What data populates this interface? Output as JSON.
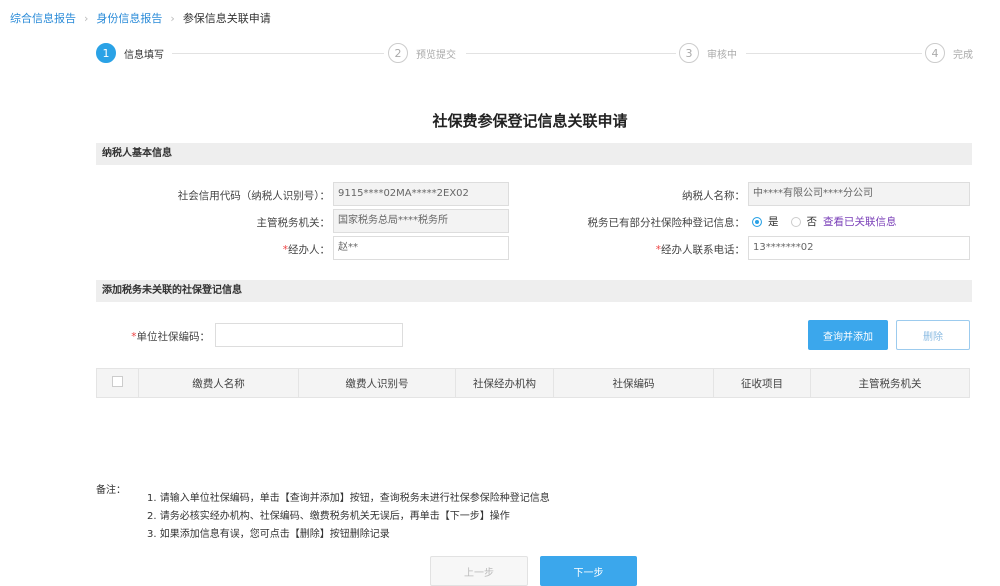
{
  "breadcrumb": [
    "综合信息报告",
    "身份信息报告",
    "参保信息关联申请"
  ],
  "steps": [
    {
      "num": "1",
      "label": "信息填写"
    },
    {
      "num": "2",
      "label": "预览提交"
    },
    {
      "num": "3",
      "label": "审核中"
    },
    {
      "num": "4",
      "label": "完成"
    }
  ],
  "title": "社保费参保登记信息关联申请",
  "section1": {
    "header": "纳税人基本信息",
    "credit_code_label": "社会信用代码（纳税人识别号）：",
    "credit_code_value": "9115****02MA*****2EX02",
    "taxpayer_name_label": "纳税人名称：",
    "taxpayer_name_value": "中****有限公司****分公司",
    "tax_authority_label": "主管税务机关：",
    "tax_authority_value": "国家税务总局****税务所",
    "registered_label": "税务已有部分社保险种登记信息：",
    "yes": "是",
    "no": "否",
    "view_link": "查看已关联信息",
    "handler_label": "经办人：",
    "handler_value": "赵**",
    "phone_label": "经办人联系电话：",
    "phone_value": "13*******02"
  },
  "section2": {
    "header": "添加税务未关联的社保登记信息",
    "unit_code_label": "单位社保编码：",
    "unit_code_value": "",
    "query_add": "查询并添加",
    "delete": "删除"
  },
  "table": {
    "columns": [
      "缴费人名称",
      "缴费人识别号",
      "社保经办机构",
      "社保编码",
      "征收项目",
      "主管税务机关"
    ]
  },
  "notes": {
    "title": "备注：",
    "items": [
      "1. 请输入单位社保编码，单击【查询并添加】按钮，查询税务未进行社保参保险种登记信息",
      "2. 请务必核实经办机构、社保编码、缴费税务机关无误后，再单击【下一步】操作",
      "3. 如果添加信息有误，您可点击【删除】按钮删除记录"
    ]
  },
  "footer": {
    "prev": "上一步",
    "next": "下一步"
  }
}
